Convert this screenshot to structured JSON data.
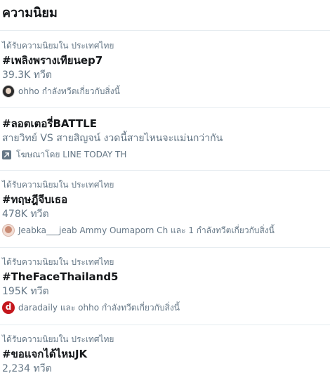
{
  "header": {
    "title": "ความนิยม"
  },
  "trends": [
    {
      "context": "ได้รับความนิยมใน ประเทศไทย",
      "tag": "#เพลิงพรางเทียนep7",
      "count": "39.3K ทวีต",
      "meta": "ohho กำลังทวีตเกี่ยวกับสิ่งนี้",
      "avatar_letter": ""
    },
    {
      "tag": "#ลอตเตอรี่BATTLE",
      "description": "สายวิทย์ VS สายสิญจน์ งวดนี้สายไหนจะแม่นกว่ากัน",
      "promoted": "โฆษณาโดย LINE TODAY TH",
      "promoted_icon": "promoted-arrow-icon"
    },
    {
      "context": "ได้รับความนิยมใน ประเทศไทย",
      "tag": "#ทฤษฎีจีบเธอ",
      "count": "478K ทวีต",
      "meta": "Jeabka___jeab Ammy Oumaporn Ch และ 1 กำลังทวีตเกี่ยวกับสิ่งนี้"
    },
    {
      "context": "ได้รับความนิยมใน ประเทศไทย",
      "tag": "#TheFaceThailand5",
      "count": "195K ทวีต",
      "meta": "daradaily และ ohho กำลังทวีตเกี่ยวกับสิ่งนี้",
      "avatar_letter": "d"
    },
    {
      "context": "ได้รับความนิยมใน ประเทศไทย",
      "tag": "#ขอแจกได้ไหมJK",
      "count": "2,234 ทวีต"
    }
  ]
}
